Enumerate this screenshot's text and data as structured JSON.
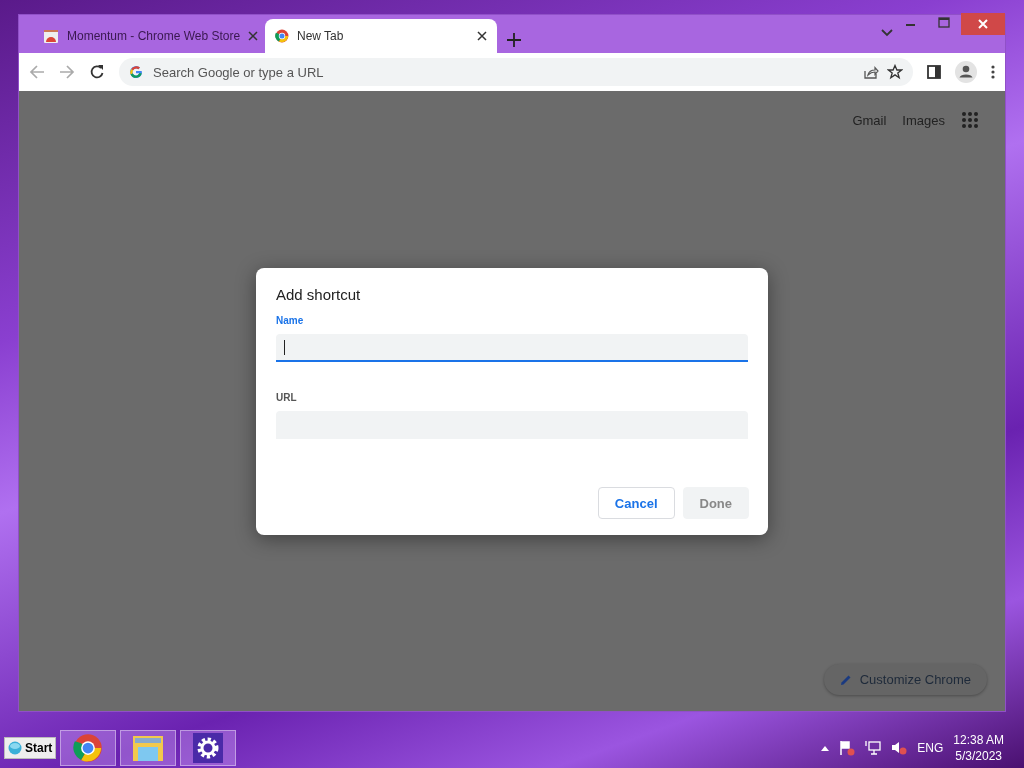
{
  "tabs": [
    {
      "title": "Momentum - Chrome Web Store",
      "selected": false,
      "kind": "store"
    },
    {
      "title": "New Tab",
      "selected": true,
      "kind": "chrome"
    }
  ],
  "omnibox": {
    "placeholder": "Search Google or type a URL"
  },
  "header_links": [
    "Gmail",
    "Images"
  ],
  "dialog": {
    "title": "Add shortcut",
    "fields": [
      {
        "label": "Name",
        "focused": true
      },
      {
        "label": "URL",
        "focused": false
      }
    ],
    "buttons": [
      {
        "label": "Cancel",
        "disabled": false
      },
      {
        "label": "Done",
        "disabled": true
      }
    ]
  },
  "customize_button": "Customize Chrome",
  "taskbar": {
    "start": "Start",
    "apps": [
      {
        "kind": "chrome"
      },
      {
        "kind": "folder"
      },
      {
        "kind": "settings"
      }
    ],
    "language": "ENG",
    "time": "12:38 AM",
    "date": "5/3/2023"
  }
}
